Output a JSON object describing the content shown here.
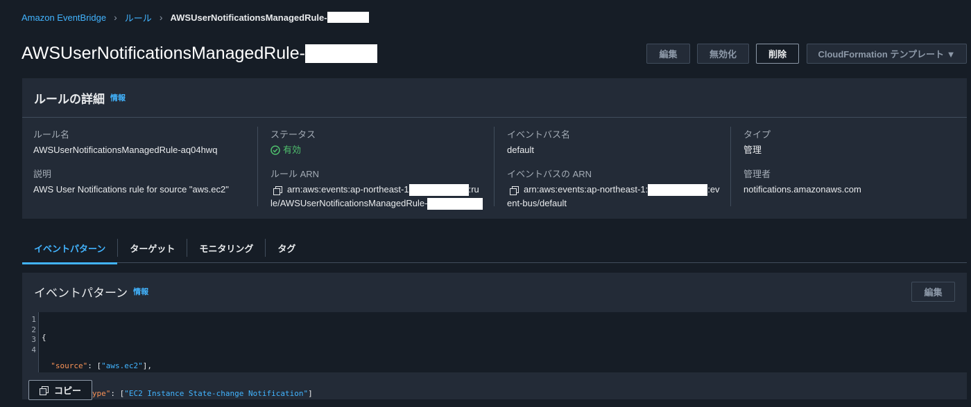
{
  "breadcrumb": {
    "items": [
      "Amazon EventBridge",
      "ルール"
    ],
    "current": "AWSUserNotificationsManagedRule-"
  },
  "header": {
    "title": "AWSUserNotificationsManagedRule-",
    "buttons": {
      "edit": "編集",
      "disable": "無効化",
      "delete": "削除",
      "cloudformation": "CloudFormation テンプレート ▼"
    }
  },
  "details": {
    "title": "ルールの詳細",
    "info": "情報",
    "rule_name_label": "ルール名",
    "rule_name": "AWSUserNotificationsManagedRule-aq04hwq",
    "description_label": "説明",
    "description": "AWS User Notifications rule for source \"aws.ec2\"",
    "status_label": "ステータス",
    "status": "有効",
    "rule_arn_label": "ルール ARN",
    "rule_arn_line1_prefix": "arn:aws:events:ap-northeast-1",
    "rule_arn_line1_suffix": ":ru",
    "rule_arn_line2_prefix": "le/AWSUserNotificationsManagedRule-",
    "event_bus_label": "イベントバス名",
    "event_bus": "default",
    "event_bus_arn_label": "イベントバスの ARN",
    "event_bus_arn_line1_prefix": "arn:aws:events:ap-northeast-1:",
    "event_bus_arn_line1_suffix": ":ev",
    "event_bus_arn_line2": "ent-bus/default",
    "type_label": "タイプ",
    "type": "管理",
    "managed_by_label": "管理者",
    "managed_by": "notifications.amazonaws.com"
  },
  "tabs": [
    "イベントパターン",
    "ターゲット",
    "モニタリング",
    "タグ"
  ],
  "pattern": {
    "title": "イベントパターン",
    "info": "情報",
    "edit": "編集",
    "line_numbers": [
      "1",
      "2",
      "3",
      "4"
    ],
    "source_key": "\"source\"",
    "source_value": "\"aws.ec2\"",
    "detail_type_key": "\"detail-type\"",
    "detail_type_value": "\"EC2 Instance State-change Notification\"",
    "copy": "コピー"
  },
  "colors": {
    "background": "#161d26",
    "panel": "#232b37",
    "link": "#42b4ff",
    "success": "#4fc06d",
    "json_key": "#f89256"
  }
}
